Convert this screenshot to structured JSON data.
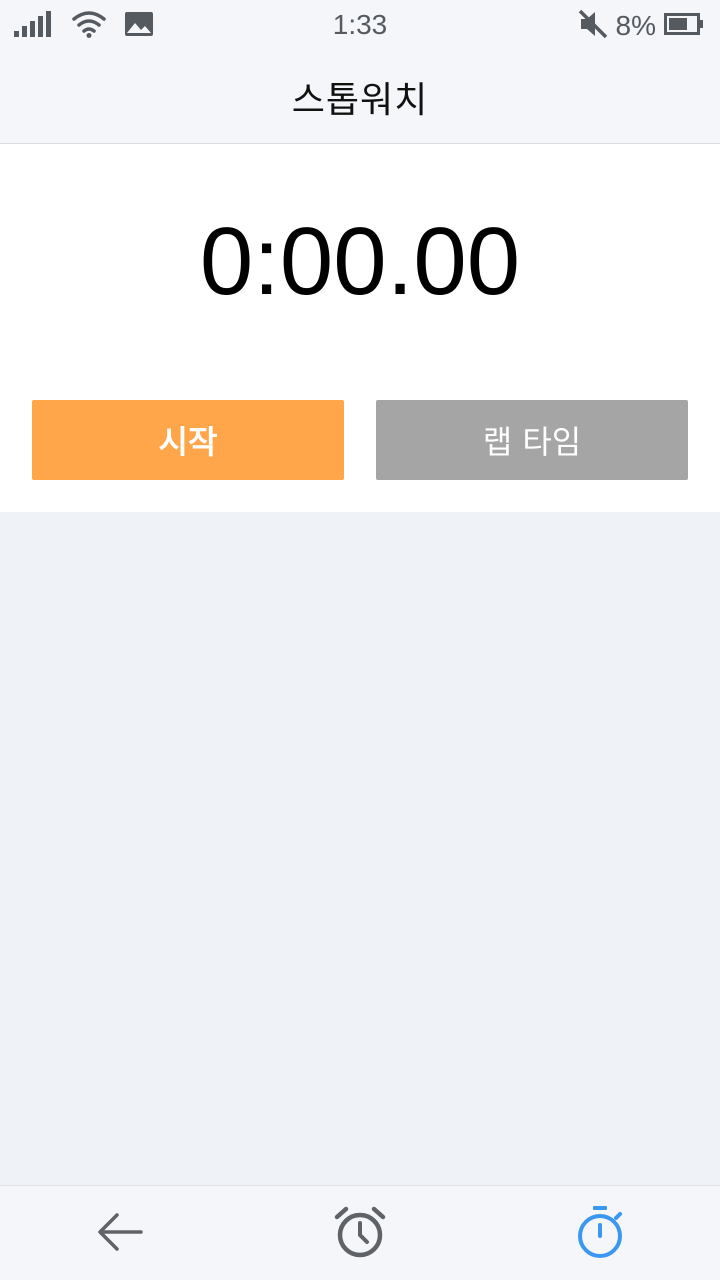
{
  "status_bar": {
    "time": "1:33",
    "battery": "8%",
    "icons": [
      "signal-icon",
      "wifi-icon",
      "image-icon",
      "mute-icon",
      "battery-icon"
    ]
  },
  "header": {
    "title": "스톱워치"
  },
  "stopwatch": {
    "display": "0:00.00",
    "start_label": "시작",
    "lap_label": "랩 타임"
  },
  "bottom_nav": {
    "items": [
      "back-icon",
      "alarm-clock-icon",
      "stopwatch-icon"
    ],
    "active": "stopwatch-icon"
  },
  "colors": {
    "start": "#ffa64a",
    "lap": "#a5a5a5",
    "active": "#3b97f0",
    "inactive": "#5f6368"
  }
}
